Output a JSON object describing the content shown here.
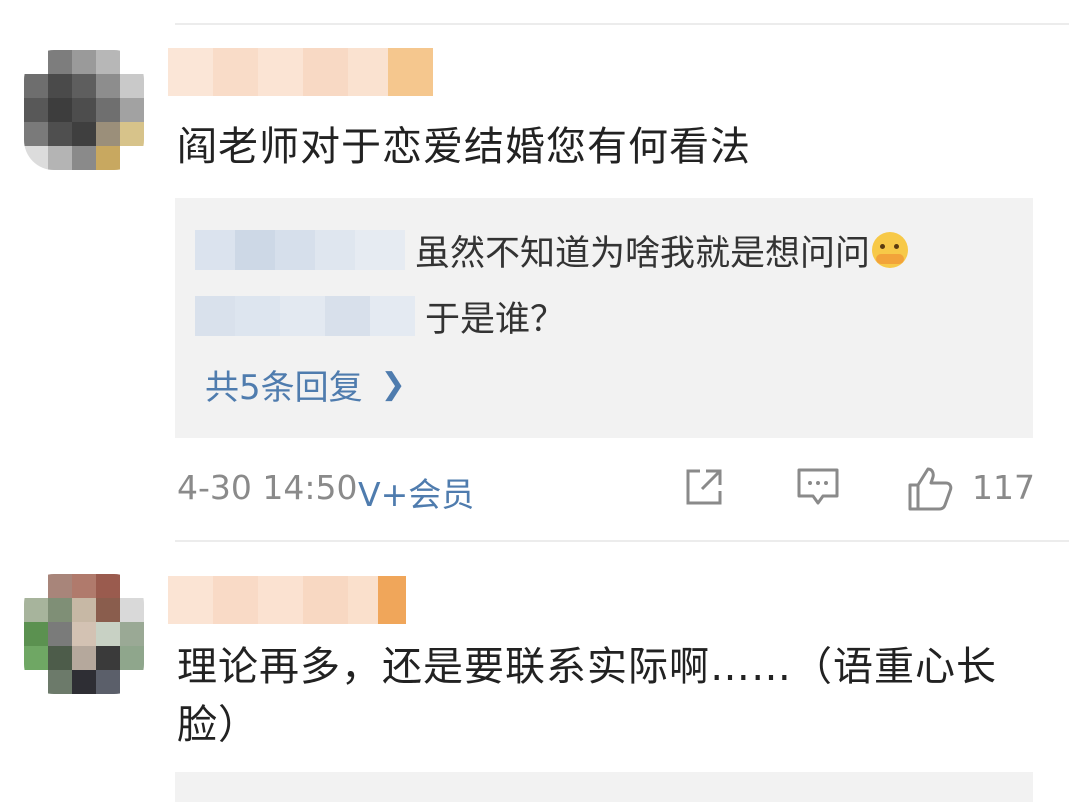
{
  "comments": [
    {
      "text": "阎老师对于恋爱结婚您有何看法",
      "replies": [
        {
          "text": "虽然不知道为啥我就是想问问",
          "emoji": "hugging-face-emoji"
        },
        {
          "text": "于是谁？"
        }
      ],
      "more_replies_label": "共5条回复",
      "time": "4-30 14:50",
      "badge": "V+会员",
      "like_count": "117"
    },
    {
      "text": "理论再多，还是要联系实际啊……（语重心长脸）"
    }
  ],
  "icons": {
    "share": "share-icon",
    "comment": "comment-icon",
    "like": "thumbs-up-icon",
    "chevron": "chevron-right-icon"
  },
  "colors": {
    "link_blue": "#4f7cae",
    "meta_gray": "#8a8a8a",
    "reply_bg": "#f2f2f2"
  }
}
